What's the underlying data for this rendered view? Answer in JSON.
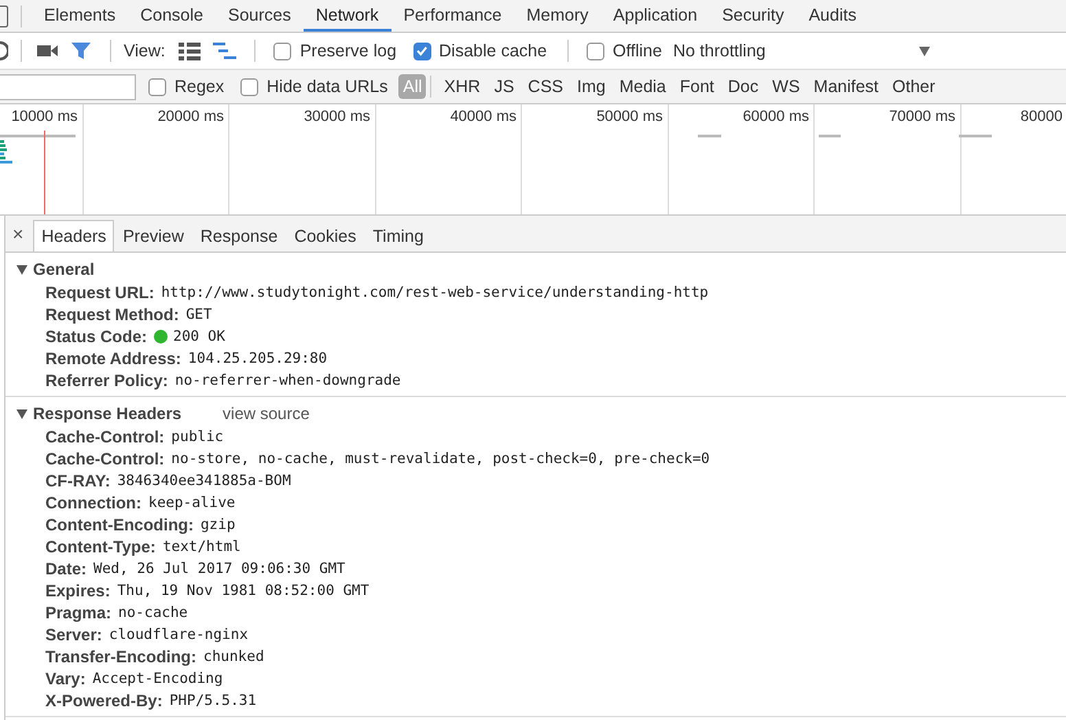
{
  "devtools_tabs": [
    {
      "label": "Elements",
      "selected": false
    },
    {
      "label": "Console",
      "selected": false
    },
    {
      "label": "Sources",
      "selected": false
    },
    {
      "label": "Network",
      "selected": true
    },
    {
      "label": "Performance",
      "selected": false
    },
    {
      "label": "Memory",
      "selected": false
    },
    {
      "label": "Application",
      "selected": false
    },
    {
      "label": "Security",
      "selected": false
    },
    {
      "label": "Audits",
      "selected": false
    }
  ],
  "toolbar": {
    "view_label": "View:",
    "view_options": [
      {
        "selected": false
      },
      {
        "selected": true
      }
    ],
    "preserve_log": {
      "label": "Preserve log",
      "checked": false
    },
    "disable_cache": {
      "label": "Disable cache",
      "checked": true
    },
    "offline": {
      "label": "Offline",
      "checked": false
    },
    "throttling": "No throttling"
  },
  "filter_bar": {
    "regex": {
      "label": "Regex",
      "checked": false
    },
    "hide_data_urls": {
      "label": "Hide data URLs",
      "checked": false
    },
    "types": [
      {
        "label": "All",
        "selected": true
      },
      {
        "label": "XHR",
        "selected": false
      },
      {
        "label": "JS",
        "selected": false
      },
      {
        "label": "CSS",
        "selected": false
      },
      {
        "label": "Img",
        "selected": false
      },
      {
        "label": "Media",
        "selected": false
      },
      {
        "label": "Font",
        "selected": false
      },
      {
        "label": "Doc",
        "selected": false
      },
      {
        "label": "WS",
        "selected": false
      },
      {
        "label": "Manifest",
        "selected": false
      },
      {
        "label": "Other",
        "selected": false
      }
    ]
  },
  "timeline": {
    "ticks": [
      "10000 ms",
      "20000 ms",
      "30000 ms",
      "40000 ms",
      "50000 ms",
      "60000 ms",
      "70000 ms",
      "80000"
    ]
  },
  "detail_tabs": [
    {
      "label": "Headers",
      "selected": true
    },
    {
      "label": "Preview",
      "selected": false
    },
    {
      "label": "Response",
      "selected": false
    },
    {
      "label": "Cookies",
      "selected": false
    },
    {
      "label": "Timing",
      "selected": false
    }
  ],
  "close_symbol": "×",
  "sections": [
    {
      "title": "General",
      "expanded": true,
      "rows": [
        {
          "name": "Request URL:",
          "value": "http://www.studytonight.com/rest-web-service/understanding-http"
        },
        {
          "name": "Request Method:",
          "value": "GET"
        },
        {
          "name": "Status Code:",
          "value": "200 OK",
          "status_dot": true
        },
        {
          "name": "Remote Address:",
          "value": "104.25.205.29:80"
        },
        {
          "name": "Referrer Policy:",
          "value": "no-referrer-when-downgrade"
        }
      ]
    },
    {
      "title": "Response Headers",
      "expanded": true,
      "link": "view source",
      "rows": [
        {
          "name": "Cache-Control:",
          "value": "public"
        },
        {
          "name": "Cache-Control:",
          "value": "no-store, no-cache, must-revalidate, post-check=0, pre-check=0"
        },
        {
          "name": "CF-RAY:",
          "value": "3846340ee341885a-BOM"
        },
        {
          "name": "Connection:",
          "value": "keep-alive"
        },
        {
          "name": "Content-Encoding:",
          "value": "gzip"
        },
        {
          "name": "Content-Type:",
          "value": "text/html"
        },
        {
          "name": "Date:",
          "value": "Wed, 26 Jul 2017 09:06:30 GMT"
        },
        {
          "name": "Expires:",
          "value": "Thu, 19 Nov 1981 08:52:00 GMT"
        },
        {
          "name": "Pragma:",
          "value": "no-cache"
        },
        {
          "name": "Server:",
          "value": "cloudflare-nginx"
        },
        {
          "name": "Transfer-Encoding:",
          "value": "chunked"
        },
        {
          "name": "Vary:",
          "value": "Accept-Encoding"
        },
        {
          "name": "X-Powered-By:",
          "value": "PHP/5.5.31"
        }
      ]
    }
  ]
}
